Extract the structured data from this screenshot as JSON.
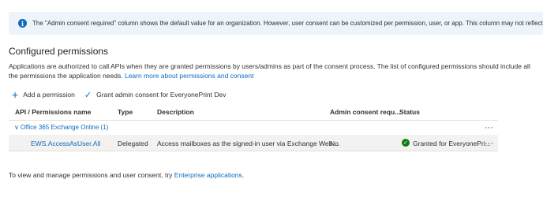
{
  "banner": {
    "icon": "info-icon",
    "text": "The \"Admin consent required\" column shows the default value for an organization. However, user consent can be customized per permission, user, or app. This column may not reflect the value in you"
  },
  "section": {
    "title": "Configured permissions",
    "description": "Applications are authorized to call APIs when they are granted permissions by users/admins as part of the consent process. The list of configured permissions should include all the permissions the application needs.",
    "learn_more_link": "Learn more about permissions and consent"
  },
  "commands": {
    "add_permission": "Add a permission",
    "grant_consent": "Grant admin consent for EveryonePrint Dev"
  },
  "table": {
    "columns": [
      "API / Permissions name",
      "Type",
      "Description",
      "Admin consent requ...",
      "Status"
    ],
    "group": {
      "label": "Office 365 Exchange Online (1)"
    },
    "rows": [
      {
        "name": "EWS.AccessAsUser.All",
        "type": "Delegated",
        "description": "Access mailboxes as the signed-in user via Exchange Web ...",
        "admin_consent": "No",
        "status": "Granted for EveryonePri..."
      }
    ],
    "more_icon": "more-icon",
    "more_glyph": "···"
  },
  "footer": {
    "text": "To view and manage permissions and user consent, try",
    "link": "Enterprise applications",
    "suffix": "."
  },
  "colors": {
    "accent": "#0f6cbd",
    "banner_bg": "#eef4fb",
    "success": "#107c10"
  }
}
